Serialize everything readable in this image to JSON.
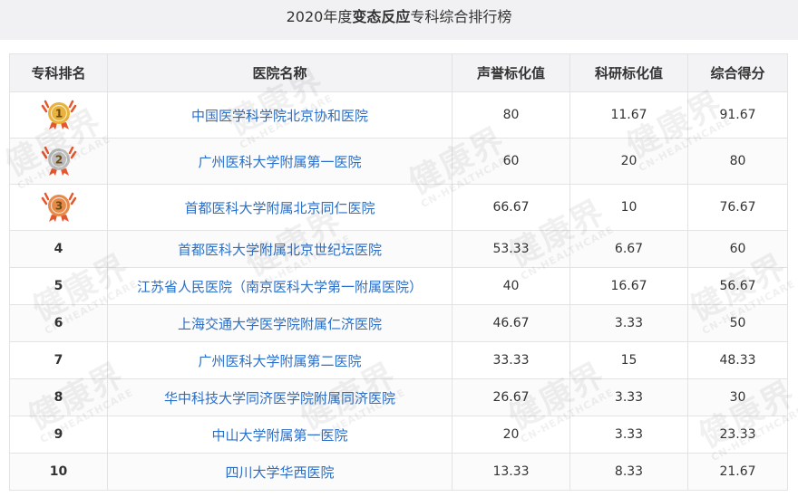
{
  "title": {
    "year": "2020年度",
    "specialty": "变态反应",
    "suffix": "专科综合排行榜"
  },
  "headers": {
    "rank": "专科排名",
    "hospital": "医院名称",
    "reputation": "声誉标化值",
    "research": "科研标化值",
    "total": "综合得分"
  },
  "watermark": {
    "main": "健康界",
    "sub": "CN-HEALTHCARE"
  },
  "medals": {
    "gold": "#e9b23a",
    "silver": "#bdbdbd",
    "bronze": "#e68a4a",
    "ribbon": "#e4572e"
  },
  "rows": [
    {
      "rank": "1",
      "medal": "gold",
      "hospital": "中国医学科学院北京协和医院",
      "reputation": "80",
      "research": "11.67",
      "total": "91.67"
    },
    {
      "rank": "2",
      "medal": "silver",
      "hospital": "广州医科大学附属第一医院",
      "reputation": "60",
      "research": "20",
      "total": "80"
    },
    {
      "rank": "3",
      "medal": "bronze",
      "hospital": "首都医科大学附属北京同仁医院",
      "reputation": "66.67",
      "research": "10",
      "total": "76.67"
    },
    {
      "rank": "4",
      "hospital": "首都医科大学附属北京世纪坛医院",
      "reputation": "53.33",
      "research": "6.67",
      "total": "60"
    },
    {
      "rank": "5",
      "hospital": "江苏省人民医院（南京医科大学第一附属医院）",
      "reputation": "40",
      "research": "16.67",
      "total": "56.67"
    },
    {
      "rank": "6",
      "hospital": "上海交通大学医学院附属仁济医院",
      "reputation": "46.67",
      "research": "3.33",
      "total": "50"
    },
    {
      "rank": "7",
      "hospital": "广州医科大学附属第二医院",
      "reputation": "33.33",
      "research": "15",
      "total": "48.33"
    },
    {
      "rank": "8",
      "hospital": "华中科技大学同济医学院附属同济医院",
      "reputation": "26.67",
      "research": "3.33",
      "total": "30"
    },
    {
      "rank": "9",
      "hospital": "中山大学附属第一医院",
      "reputation": "20",
      "research": "3.33",
      "total": "23.33"
    },
    {
      "rank": "10",
      "hospital": "四川大学华西医院",
      "reputation": "13.33",
      "research": "8.33",
      "total": "21.67"
    }
  ]
}
